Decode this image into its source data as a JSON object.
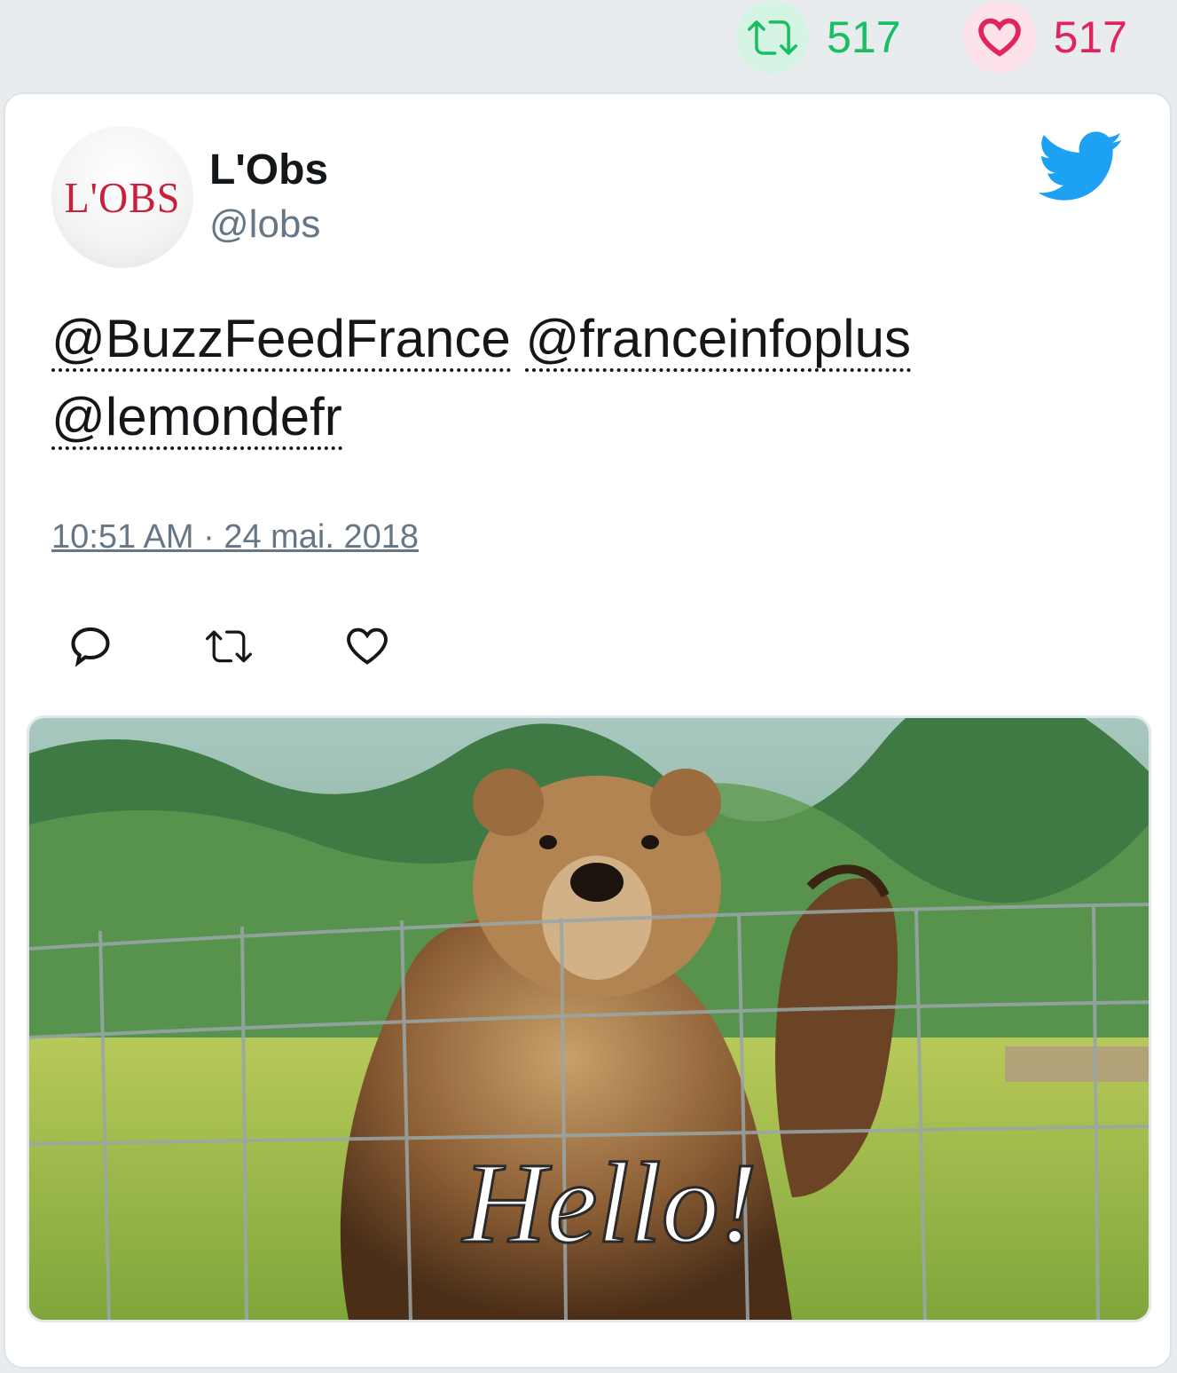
{
  "top_stats": {
    "retweet_count": "517",
    "like_count": "517",
    "retweet_color": "#17bf63",
    "like_color": "#e0245e"
  },
  "tweet": {
    "author": {
      "name": "L'Obs",
      "handle": "@lobs",
      "avatar_text": "L'OBS"
    },
    "mentions": [
      "@BuzzFeedFrance",
      "@franceinfoplus",
      "@lemondefr"
    ],
    "timestamp": "10:51 AM · 24 mai. 2018",
    "media": {
      "caption": "Hello!"
    }
  },
  "icons": {
    "top_retweet": "retweet-icon",
    "top_like": "heart-icon",
    "brand": "twitter-bird-icon",
    "reply": "reply-icon",
    "retweet": "retweet-icon",
    "like": "heart-icon"
  },
  "colors": {
    "twitter_blue": "#1da1f2",
    "handle_gray": "#657786"
  }
}
